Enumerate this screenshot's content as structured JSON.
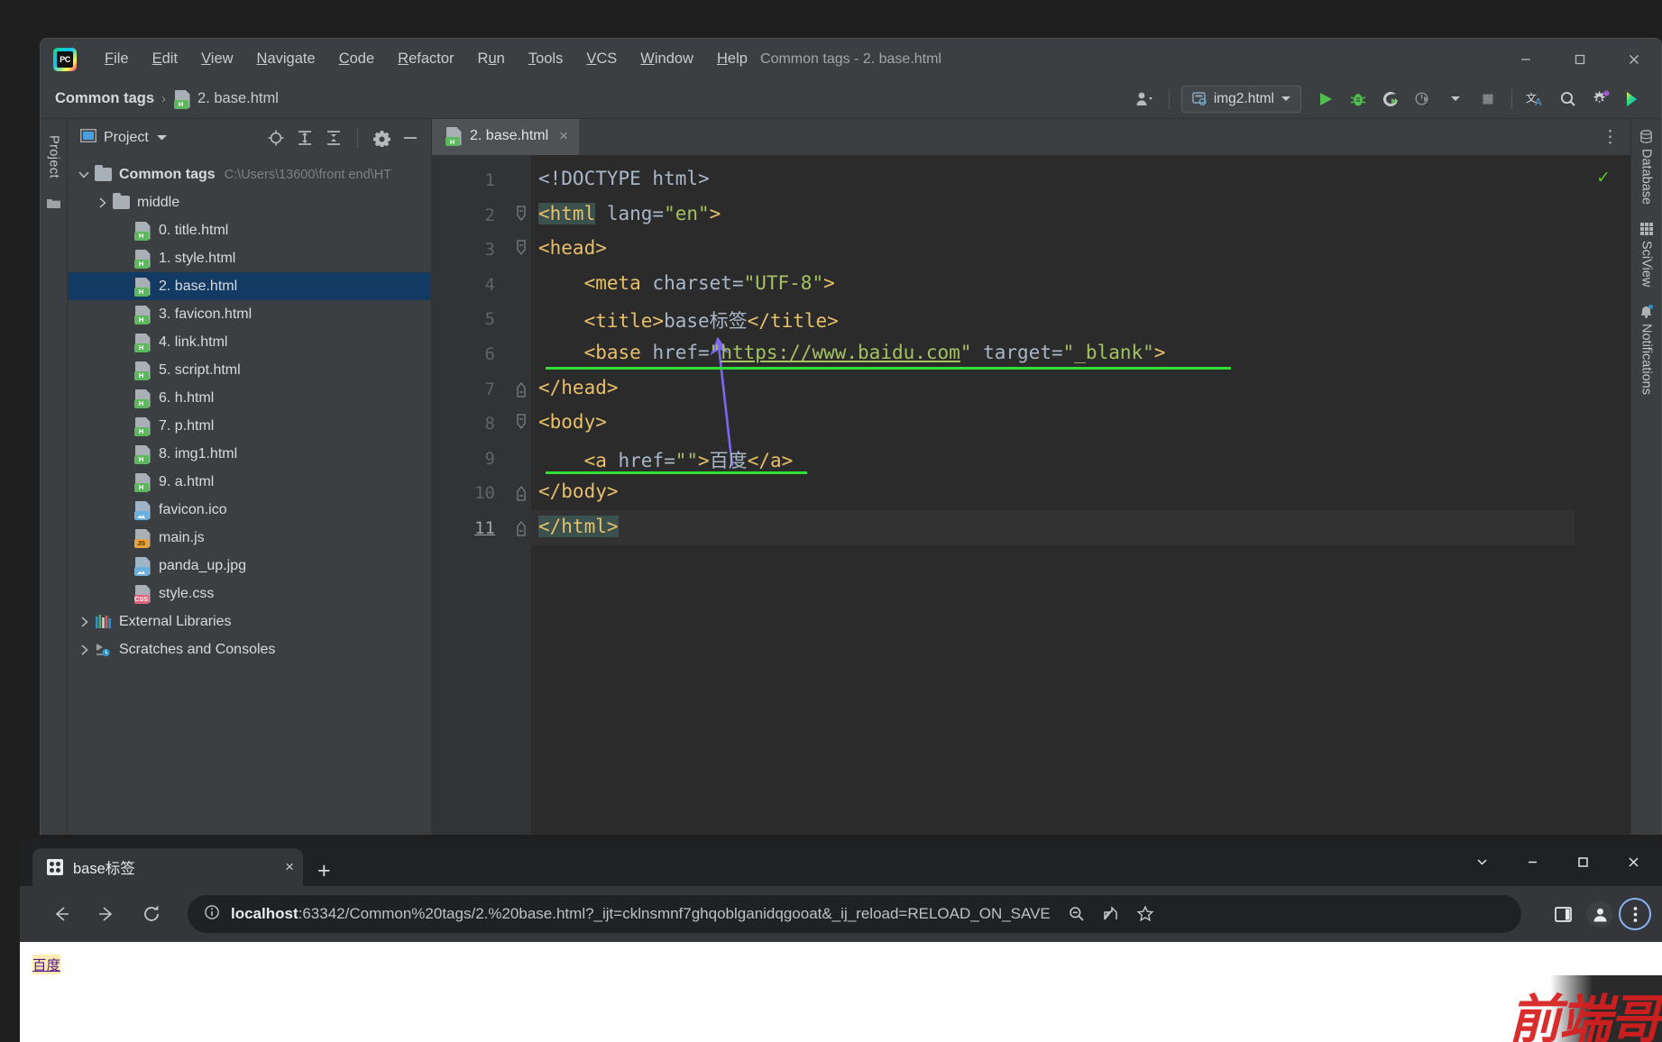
{
  "ide": {
    "window_title": "Common tags - 2. base.html",
    "logo_text": "PC",
    "menu": [
      {
        "label": "File",
        "mnemonic": "F"
      },
      {
        "label": "Edit",
        "mnemonic": "E"
      },
      {
        "label": "View",
        "mnemonic": "V"
      },
      {
        "label": "Navigate",
        "mnemonic": "N"
      },
      {
        "label": "Code",
        "mnemonic": "C"
      },
      {
        "label": "Refactor",
        "mnemonic": "R"
      },
      {
        "label": "Run",
        "mnemonic": "u"
      },
      {
        "label": "Tools",
        "mnemonic": "T"
      },
      {
        "label": "VCS",
        "mnemonic": "V"
      },
      {
        "label": "Window",
        "mnemonic": "W"
      },
      {
        "label": "Help",
        "mnemonic": "H"
      }
    ],
    "window_controls": [
      "minimize-icon",
      "maximize-icon",
      "close-icon"
    ],
    "breadcrumb": {
      "project": "Common tags",
      "separator": "›",
      "file": "2. base.html"
    },
    "toolbar": {
      "run_config": "img2.html",
      "icons": [
        "user-dropdown-icon",
        "run-icon",
        "debug-icon",
        "run-coverage-icon",
        "profile-icon",
        "stop-icon",
        "translate-icon",
        "search-icon",
        "settings-gear-icon",
        "plugin-icon"
      ]
    },
    "left_strip": {
      "tab": "Project"
    },
    "project_panel": {
      "title": "Project",
      "header_icons": [
        "locate-icon",
        "expand-all-icon",
        "collapse-all-icon",
        "settings-icon",
        "hide-icon"
      ],
      "tree": [
        {
          "label": "Common tags",
          "path": "C:\\Users\\13600\\front end\\HT",
          "icon": "folder-icon",
          "arrow": "down",
          "indent": 0,
          "bold": true,
          "selected": false
        },
        {
          "label": "middle",
          "path": "",
          "icon": "folder-icon",
          "arrow": "right",
          "indent": 1,
          "bold": false,
          "selected": false
        },
        {
          "label": "0. title.html",
          "path": "",
          "icon": "html-file-icon",
          "arrow": "none",
          "indent": 2,
          "bold": false,
          "selected": false
        },
        {
          "label": "1. style.html",
          "path": "",
          "icon": "html-file-icon",
          "arrow": "none",
          "indent": 2,
          "bold": false,
          "selected": false
        },
        {
          "label": "2. base.html",
          "path": "",
          "icon": "html-file-icon",
          "arrow": "none",
          "indent": 2,
          "bold": false,
          "selected": true
        },
        {
          "label": "3. favicon.html",
          "path": "",
          "icon": "html-file-icon",
          "arrow": "none",
          "indent": 2,
          "bold": false,
          "selected": false
        },
        {
          "label": "4. link.html",
          "path": "",
          "icon": "html-file-icon",
          "arrow": "none",
          "indent": 2,
          "bold": false,
          "selected": false
        },
        {
          "label": "5. script.html",
          "path": "",
          "icon": "html-file-icon",
          "arrow": "none",
          "indent": 2,
          "bold": false,
          "selected": false
        },
        {
          "label": "6. h.html",
          "path": "",
          "icon": "html-file-icon",
          "arrow": "none",
          "indent": 2,
          "bold": false,
          "selected": false
        },
        {
          "label": "7. p.html",
          "path": "",
          "icon": "html-file-icon",
          "arrow": "none",
          "indent": 2,
          "bold": false,
          "selected": false
        },
        {
          "label": "8. img1.html",
          "path": "",
          "icon": "html-file-icon",
          "arrow": "none",
          "indent": 2,
          "bold": false,
          "selected": false
        },
        {
          "label": "9. a.html",
          "path": "",
          "icon": "html-file-icon",
          "arrow": "none",
          "indent": 2,
          "bold": false,
          "selected": false
        },
        {
          "label": "favicon.ico",
          "path": "",
          "icon": "image-file-icon",
          "arrow": "none",
          "indent": 2,
          "bold": false,
          "selected": false
        },
        {
          "label": "main.js",
          "path": "",
          "icon": "js-file-icon",
          "arrow": "none",
          "indent": 2,
          "bold": false,
          "selected": false
        },
        {
          "label": "panda_up.jpg",
          "path": "",
          "icon": "image-file-icon",
          "arrow": "none",
          "indent": 2,
          "bold": false,
          "selected": false
        },
        {
          "label": "style.css",
          "path": "",
          "icon": "css-file-icon",
          "arrow": "none",
          "indent": 2,
          "bold": false,
          "selected": false
        },
        {
          "label": "External Libraries",
          "path": "",
          "icon": "libraries-icon",
          "arrow": "right",
          "indent": 0,
          "bold": false,
          "selected": false
        },
        {
          "label": "Scratches and Consoles",
          "path": "",
          "icon": "scratches-icon",
          "arrow": "right",
          "indent": 0,
          "bold": false,
          "selected": false
        }
      ]
    },
    "editor": {
      "tab": {
        "label": "2. base.html",
        "close": "×",
        "icon": "html-file-icon"
      },
      "inspection_status": "✓",
      "lines": [
        {
          "n": "1",
          "fold": "none"
        },
        {
          "n": "2",
          "fold": "open"
        },
        {
          "n": "3",
          "fold": "open"
        },
        {
          "n": "4",
          "fold": "none"
        },
        {
          "n": "5",
          "fold": "none"
        },
        {
          "n": "6",
          "fold": "none"
        },
        {
          "n": "7",
          "fold": "close"
        },
        {
          "n": "8",
          "fold": "open"
        },
        {
          "n": "9",
          "fold": "none"
        },
        {
          "n": "10",
          "fold": "close"
        },
        {
          "n": "11",
          "fold": "close"
        }
      ],
      "code_text": [
        "<!DOCTYPE html>",
        "<html lang=\"en\">",
        "<head>",
        "    <meta charset=\"UTF-8\">",
        "    <title>base标签</title>",
        "    <base href=\"https://www.baidu.com\" target=\"_blank\">",
        "</head>",
        "<body>",
        "    <a href=\"\">百度</a>",
        "</body>",
        "</html>"
      ],
      "annotation": {
        "type": "arrow",
        "color": "#7b68ee",
        "from_line": 9,
        "to_line": 6,
        "underline_color": "#31e034"
      }
    },
    "right_strip": [
      {
        "label": "Database",
        "icon": "database-icon"
      },
      {
        "label": "SciView",
        "icon": "grid-icon"
      },
      {
        "label": "Notifications",
        "icon": "bell-icon",
        "badge": true
      }
    ]
  },
  "browser": {
    "tab": {
      "title": "base标签",
      "close": "×",
      "favicon": "grid-favicon"
    },
    "new_tab": "+",
    "window_controls": [
      "chevron-down-icon",
      "minimize-icon",
      "maximize-icon",
      "close-icon"
    ],
    "nav_icons": [
      "back-icon",
      "forward-icon",
      "reload-icon"
    ],
    "url": {
      "info_icon": "ⓘ",
      "host": "localhost",
      "rest": ":63342/Common%20tags/2.%20base.html?_ijt=cklnsmnf7ghqoblganidqgooat&_ij_reload=RELOAD_ON_SAVE"
    },
    "omni_icons": [
      "zoom-out-icon",
      "share-icon",
      "bookmark-star-icon"
    ],
    "toolbar_icons": [
      "side-panel-icon",
      "profile-avatar-icon",
      "kebab-menu-icon"
    ],
    "page": {
      "link_text": "百度",
      "watermark": "前端哥"
    }
  },
  "colors": {
    "ide_chrome": "#3c3f41",
    "editor_bg": "#2b2b2b",
    "selection": "#123a63",
    "tag": "#e8bf6a",
    "value": "#a5c261",
    "plain": "#a9b7c6",
    "annotation": "#7b68ee",
    "underline": "#31e034",
    "accent_green": "#59a869",
    "browser_chrome": "#35363a",
    "visited_link": "#551a8b",
    "watermark_red": "#d81e1e"
  }
}
